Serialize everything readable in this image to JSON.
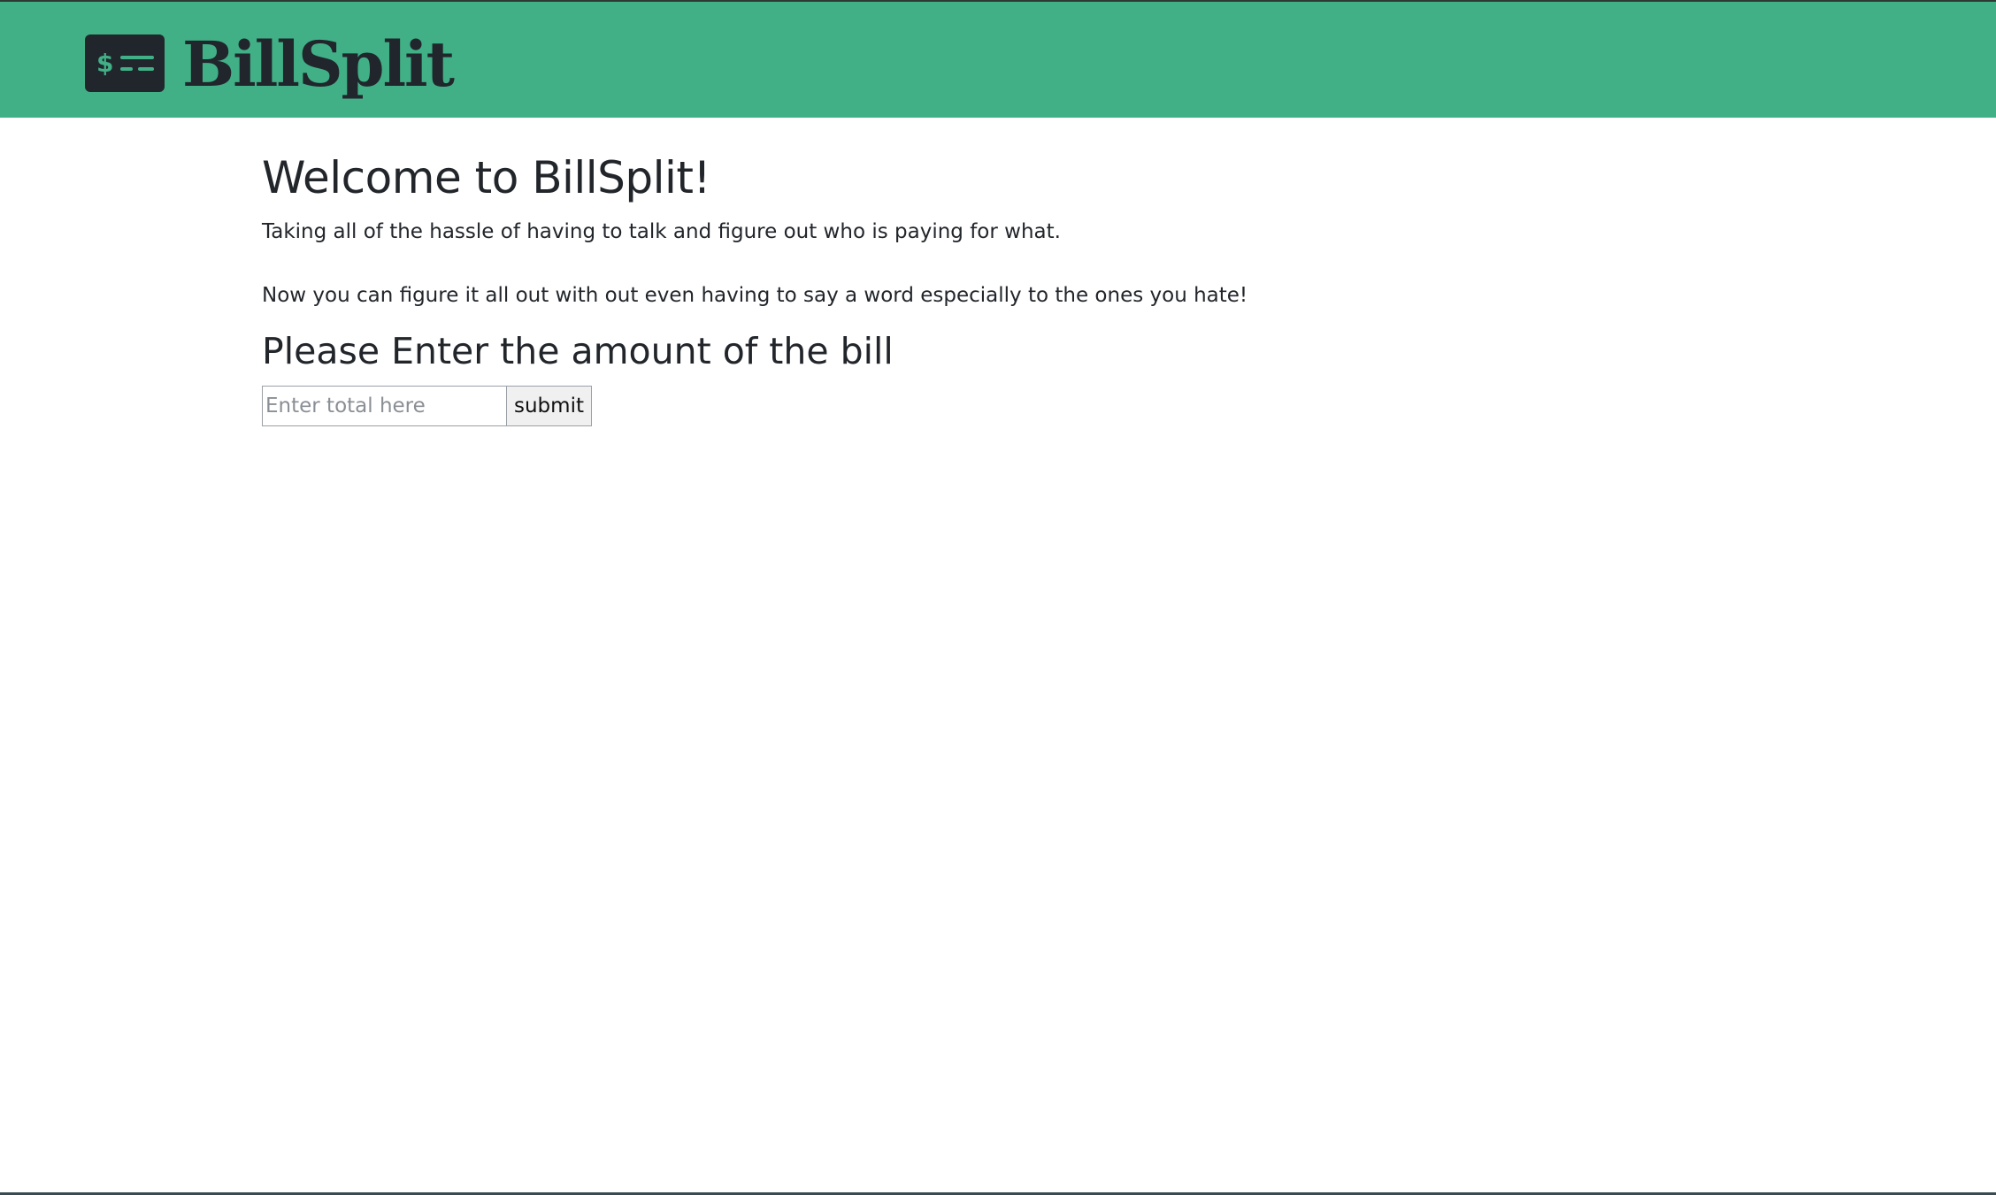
{
  "header": {
    "logo_icon": "dollar-list-icon",
    "brand_title": "BillSplit",
    "background_color": "#42b086",
    "logo_color": "#20262c"
  },
  "main": {
    "welcome_title": "Welcome to BillSplit!",
    "intro_line_1": "Taking all of the hassle of having to talk and figure out who is paying for what.",
    "intro_line_2": "Now you can figure it all out with out even having to say a word especially to the ones you hate!",
    "bill_heading": "Please Enter the amount of the bill",
    "form": {
      "total_input_value": "",
      "total_input_placeholder": "Enter total here",
      "submit_label": "submit"
    }
  }
}
